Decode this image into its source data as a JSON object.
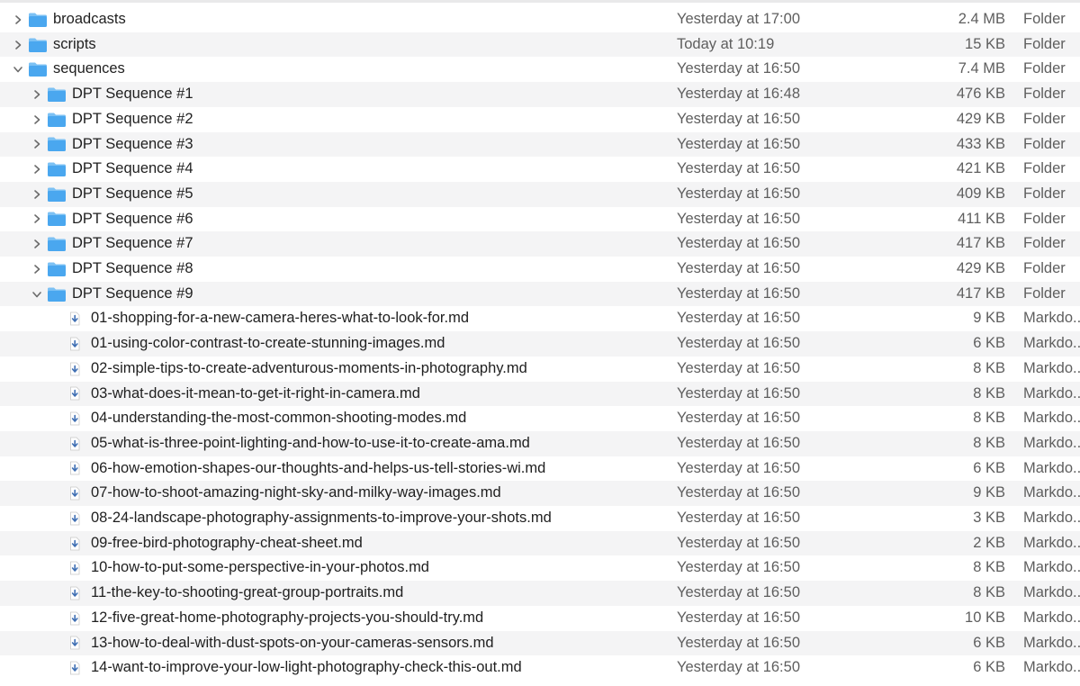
{
  "rows": [
    {
      "depth": 0,
      "type": "folder",
      "expanded": false,
      "name": "broadcasts",
      "date": "Yesterday at 17:00",
      "size": "2.4 MB",
      "kind": "Folder"
    },
    {
      "depth": 0,
      "type": "folder",
      "expanded": false,
      "name": "scripts",
      "date": "Today at 10:19",
      "size": "15 KB",
      "kind": "Folder"
    },
    {
      "depth": 0,
      "type": "folder",
      "expanded": true,
      "name": "sequences",
      "date": "Yesterday at 16:50",
      "size": "7.4 MB",
      "kind": "Folder"
    },
    {
      "depth": 1,
      "type": "folder",
      "expanded": false,
      "name": "DPT Sequence #1",
      "date": "Yesterday at 16:48",
      "size": "476 KB",
      "kind": "Folder"
    },
    {
      "depth": 1,
      "type": "folder",
      "expanded": false,
      "name": "DPT Sequence #2",
      "date": "Yesterday at 16:50",
      "size": "429 KB",
      "kind": "Folder"
    },
    {
      "depth": 1,
      "type": "folder",
      "expanded": false,
      "name": "DPT Sequence #3",
      "date": "Yesterday at 16:50",
      "size": "433 KB",
      "kind": "Folder"
    },
    {
      "depth": 1,
      "type": "folder",
      "expanded": false,
      "name": "DPT Sequence #4",
      "date": "Yesterday at 16:50",
      "size": "421 KB",
      "kind": "Folder"
    },
    {
      "depth": 1,
      "type": "folder",
      "expanded": false,
      "name": "DPT Sequence #5",
      "date": "Yesterday at 16:50",
      "size": "409 KB",
      "kind": "Folder"
    },
    {
      "depth": 1,
      "type": "folder",
      "expanded": false,
      "name": "DPT Sequence #6",
      "date": "Yesterday at 16:50",
      "size": "411 KB",
      "kind": "Folder"
    },
    {
      "depth": 1,
      "type": "folder",
      "expanded": false,
      "name": "DPT Sequence #7",
      "date": "Yesterday at 16:50",
      "size": "417 KB",
      "kind": "Folder"
    },
    {
      "depth": 1,
      "type": "folder",
      "expanded": false,
      "name": "DPT Sequence #8",
      "date": "Yesterday at 16:50",
      "size": "429 KB",
      "kind": "Folder"
    },
    {
      "depth": 1,
      "type": "folder",
      "expanded": true,
      "name": "DPT Sequence #9",
      "date": "Yesterday at 16:50",
      "size": "417 KB",
      "kind": "Folder"
    },
    {
      "depth": 2,
      "type": "file",
      "name": "01-shopping-for-a-new-camera-heres-what-to-look-for.md",
      "date": "Yesterday at 16:50",
      "size": "9 KB",
      "kind": "Markdo..."
    },
    {
      "depth": 2,
      "type": "file",
      "name": "01-using-color-contrast-to-create-stunning-images.md",
      "date": "Yesterday at 16:50",
      "size": "6 KB",
      "kind": "Markdo..."
    },
    {
      "depth": 2,
      "type": "file",
      "name": "02-simple-tips-to-create-adventurous-moments-in-photography.md",
      "date": "Yesterday at 16:50",
      "size": "8 KB",
      "kind": "Markdo..."
    },
    {
      "depth": 2,
      "type": "file",
      "name": "03-what-does-it-mean-to-get-it-right-in-camera.md",
      "date": "Yesterday at 16:50",
      "size": "8 KB",
      "kind": "Markdo..."
    },
    {
      "depth": 2,
      "type": "file",
      "name": "04-understanding-the-most-common-shooting-modes.md",
      "date": "Yesterday at 16:50",
      "size": "8 KB",
      "kind": "Markdo..."
    },
    {
      "depth": 2,
      "type": "file",
      "name": "05-what-is-three-point-lighting-and-how-to-use-it-to-create-ama.md",
      "date": "Yesterday at 16:50",
      "size": "8 KB",
      "kind": "Markdo..."
    },
    {
      "depth": 2,
      "type": "file",
      "name": "06-how-emotion-shapes-our-thoughts-and-helps-us-tell-stories-wi.md",
      "date": "Yesterday at 16:50",
      "size": "6 KB",
      "kind": "Markdo..."
    },
    {
      "depth": 2,
      "type": "file",
      "name": "07-how-to-shoot-amazing-night-sky-and-milky-way-images.md",
      "date": "Yesterday at 16:50",
      "size": "9 KB",
      "kind": "Markdo..."
    },
    {
      "depth": 2,
      "type": "file",
      "name": "08-24-landscape-photography-assignments-to-improve-your-shots.md",
      "date": "Yesterday at 16:50",
      "size": "3 KB",
      "kind": "Markdo..."
    },
    {
      "depth": 2,
      "type": "file",
      "name": "09-free-bird-photography-cheat-sheet.md",
      "date": "Yesterday at 16:50",
      "size": "2 KB",
      "kind": "Markdo..."
    },
    {
      "depth": 2,
      "type": "file",
      "name": "10-how-to-put-some-perspective-in-your-photos.md",
      "date": "Yesterday at 16:50",
      "size": "8 KB",
      "kind": "Markdo..."
    },
    {
      "depth": 2,
      "type": "file",
      "name": "11-the-key-to-shooting-great-group-portraits.md",
      "date": "Yesterday at 16:50",
      "size": "8 KB",
      "kind": "Markdo..."
    },
    {
      "depth": 2,
      "type": "file",
      "name": "12-five-great-home-photography-projects-you-should-try.md",
      "date": "Yesterday at 16:50",
      "size": "10 KB",
      "kind": "Markdo..."
    },
    {
      "depth": 2,
      "type": "file",
      "name": "13-how-to-deal-with-dust-spots-on-your-cameras-sensors.md",
      "date": "Yesterday at 16:50",
      "size": "6 KB",
      "kind": "Markdo..."
    },
    {
      "depth": 2,
      "type": "file",
      "name": "14-want-to-improve-your-low-light-photography-check-this-out.md",
      "date": "Yesterday at 16:50",
      "size": "6 KB",
      "kind": "Markdo..."
    }
  ],
  "colors": {
    "folder": "#4aa7ef",
    "folder_tab": "#7cc1f4",
    "file_arrow": "#3f6fb3",
    "row_alt": "#f4f4f5",
    "secondary_text": "#5e5e5e"
  },
  "icons": {
    "folder": "folder-icon",
    "file": "markdown-file-icon",
    "collapsed": "chevron-right-icon",
    "expanded": "chevron-down-icon"
  }
}
